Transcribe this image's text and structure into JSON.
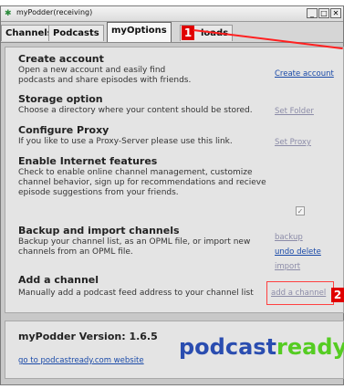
{
  "window": {
    "title": "myPodder(receiving)",
    "controls": {
      "minimize": "_",
      "maximize": "□",
      "close": "✕"
    }
  },
  "tabs": [
    {
      "label": "Channels",
      "active": false
    },
    {
      "label": "Podcasts",
      "active": false
    },
    {
      "label": "myOptions",
      "active": true
    },
    {
      "label": "loads",
      "active": false
    }
  ],
  "markers": {
    "one": "1",
    "two": "2"
  },
  "sections": {
    "create_account": {
      "title": "Create account",
      "desc": "Open a new account and easily find podcasts and share episodes with friends.",
      "link": "Create account"
    },
    "storage": {
      "title": "Storage option",
      "desc": "Choose a directory where your content should be stored.",
      "link": "Set Folder"
    },
    "proxy": {
      "title": "Configure Proxy",
      "desc": "If you like to use a Proxy-Server please use this link.",
      "link": "Set Proxy"
    },
    "internet": {
      "title": "Enable Internet features",
      "desc": "Check to enable online channel management, customize channel behavior, sign up for recommendations and recieve episode suggestions from your friends.",
      "checkbox_mark": "✓"
    },
    "backup": {
      "title": "Backup and import channels",
      "desc": "Backup your channel list, as an OPML file, or import new channels from an OPML file.",
      "links": [
        "backup",
        "undo delete",
        "import"
      ]
    },
    "add_channel": {
      "title": "Add a channel",
      "desc": "Manually add a podcast feed address to your channel list",
      "link": "add a channel"
    }
  },
  "version": {
    "label": "myPodder Version: 1.6.5",
    "website_link": "go to podcastready.com website",
    "logo_part1": "podcast",
    "logo_part2": "ready",
    "logo_tm": "™"
  },
  "colors": {
    "marker_red": "#e00000",
    "logo_blue": "#2a4db0",
    "logo_green": "#55cc22",
    "link_blue": "#1a4aa8"
  }
}
